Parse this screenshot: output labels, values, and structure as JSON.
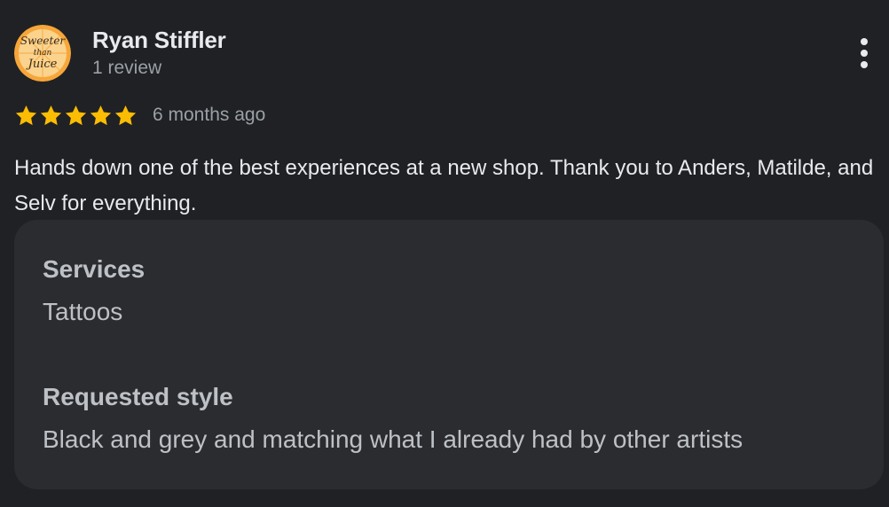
{
  "author": {
    "name": "Ryan Stiffler",
    "review_count": "1 review",
    "avatar_icon": "sweeter-than-juice-logo",
    "avatar_text_line1": "Sweeter",
    "avatar_text_line2": "than",
    "avatar_text_line3": "Juice"
  },
  "rating": {
    "stars": 5,
    "max_stars": 5,
    "star_color": "#fbbc04",
    "date": "6 months ago"
  },
  "review": {
    "text": "Hands down one of the best experiences at a new shop. Thank you to Anders, Matilde, and Selv for everything."
  },
  "details": {
    "services_label": "Services",
    "services_value": "Tattoos",
    "style_label": "Requested style",
    "style_value": "Black and grey and matching what I already had by other artists"
  },
  "menu": {
    "icon": "more-vertical-icon"
  },
  "colors": {
    "background": "#202124",
    "card": "#2b2c2f",
    "text_primary": "#e8eaed",
    "text_secondary": "#9aa0a6"
  }
}
